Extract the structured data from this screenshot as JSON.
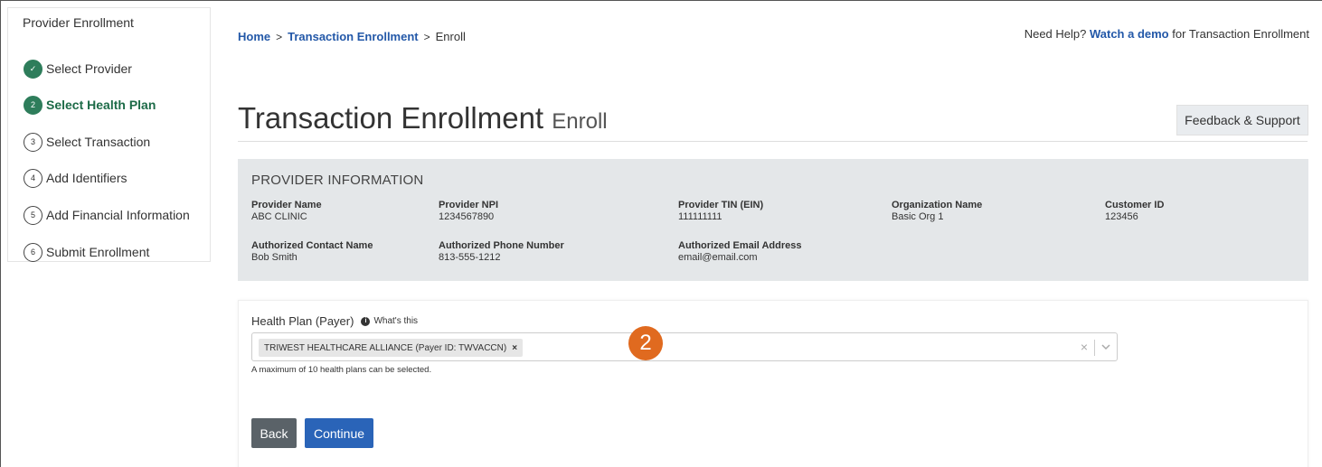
{
  "sidebar": {
    "title": "Provider Enrollment",
    "steps": [
      {
        "num": "✓",
        "label": "Select Provider",
        "state": "done"
      },
      {
        "num": "2",
        "label": "Select Health Plan",
        "state": "active"
      },
      {
        "num": "3",
        "label": "Select Transaction",
        "state": "pending"
      },
      {
        "num": "4",
        "label": "Add Identifiers",
        "state": "pending"
      },
      {
        "num": "5",
        "label": "Add Financial Information",
        "state": "pending"
      },
      {
        "num": "6",
        "label": "Submit Enrollment",
        "state": "pending"
      }
    ]
  },
  "breadcrumb": {
    "home": "Home",
    "sep": ">",
    "section": "Transaction Enrollment",
    "current": "Enroll"
  },
  "help": {
    "prefix": "Need Help?",
    "link": "Watch a demo",
    "suffix": "for Transaction Enrollment"
  },
  "page": {
    "title": "Transaction Enrollment",
    "subtitle": "Enroll"
  },
  "feedback_button": "Feedback & Support",
  "provider_info": {
    "heading": "PROVIDER INFORMATION",
    "fields": [
      {
        "label": "Provider Name",
        "value": "ABC CLINIC"
      },
      {
        "label": "Provider NPI",
        "value": "1234567890"
      },
      {
        "label": "Provider TIN (EIN)",
        "value": "111111111"
      },
      {
        "label": "Organization Name",
        "value": "Basic Org 1"
      },
      {
        "label": "Customer ID",
        "value": "123456"
      },
      {
        "label": "Authorized Contact Name",
        "value": "Bob Smith"
      },
      {
        "label": "Authorized Phone Number",
        "value": "813-555-1212"
      },
      {
        "label": "Authorized Email Address",
        "value": "email@email.com"
      }
    ]
  },
  "health_plan": {
    "label": "Health Plan (Payer)",
    "info_icon": "info-icon",
    "whats_this": "What's this",
    "selected_chip": "TRIWEST HEALTHCARE ALLIANCE (Payer ID: TWVACCN)",
    "chip_remove": "×",
    "clear": "×",
    "chevron": "⌄",
    "hint": "A maximum of 10 health plans can be selected."
  },
  "callout_badge": "2",
  "buttons": {
    "back": "Back",
    "continue": "Continue"
  },
  "colors": {
    "step_active": "#2e7d5b",
    "link": "#2358a8",
    "continue_button": "#2a64b8",
    "back_button": "#5a6268",
    "callout": "#e06a1f",
    "panel_bg": "#e4e7e9"
  }
}
